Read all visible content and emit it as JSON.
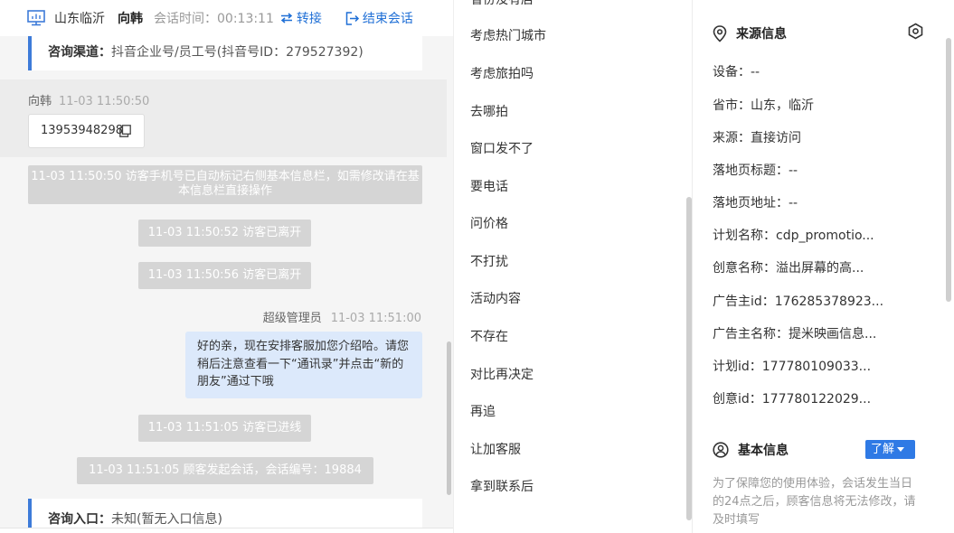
{
  "header": {
    "region": "山东临沂",
    "visitor_name": "向韩",
    "session_time_label": "会话时间：00:13:11",
    "transfer_label": "转接",
    "end_session_label": "结束会话"
  },
  "channel": {
    "label": "咨询渠道：",
    "value": "抖音企业号/员工号(抖音号ID：279527392)"
  },
  "visitor_message": {
    "sender": "向韩",
    "time": "11-03 11:50:50",
    "phone": "13953948298"
  },
  "system_messages": {
    "phone_notice": "11-03 11:50:50 访客手机号已自动标记右侧基本信息栏，如需修改请在基本信息栏直接操作",
    "left_1": "11-03 11:50:52 访客已离开",
    "left_2": "11-03 11:50:56 访客已离开",
    "joined": "11-03 11:51:05 访客已进线",
    "session_started": "11-03 11:51:05 顾客发起会话，会话编号：19884"
  },
  "admin_message": {
    "sender": "超级管理员",
    "time": "11-03 11:51:00",
    "text": "好的亲，现在安排客服加您介绍哈。请您稍后注意查看一下“通讯录”并点击“新的朋友”通过下哦"
  },
  "entry": {
    "label": "咨询入口：",
    "value": "未知(暂无入口信息)"
  },
  "quick_replies": [
    "省份没有店",
    "考虑热门城市",
    "考虑旅拍吗",
    "去哪拍",
    "窗口发不了",
    "要电话",
    "问价格",
    "不打扰",
    "活动内容",
    "不存在",
    "对比再决定",
    "再追",
    "让加客服",
    "拿到联系后"
  ],
  "source_info": {
    "title": "来源信息",
    "fields": [
      "设备：--",
      "省市：山东，临沂",
      "来源：直接访问",
      "落地页标题：--",
      "落地页地址：--",
      "计划名称：cdp_promotio...",
      "创意名称：溢出屏幕的高...",
      "广告主id：176285378923...",
      "广告主名称：提米映画信息...",
      "计划id：177780109033...",
      "创意id：177780122029..."
    ]
  },
  "basic_info": {
    "title": "基本信息",
    "learn_label": "了解",
    "notice": "为了保障您的使用体验，会话发生当日的24点之后，顾客信息将无法修改，请及时填写"
  },
  "colors": {
    "accent": "#1f6fd6",
    "channel_bar": "#3d7bd9",
    "admin_bubble": "#dce9fb",
    "system_bubble": "#d5d5d5",
    "learn_button": "#2f7ae5"
  }
}
